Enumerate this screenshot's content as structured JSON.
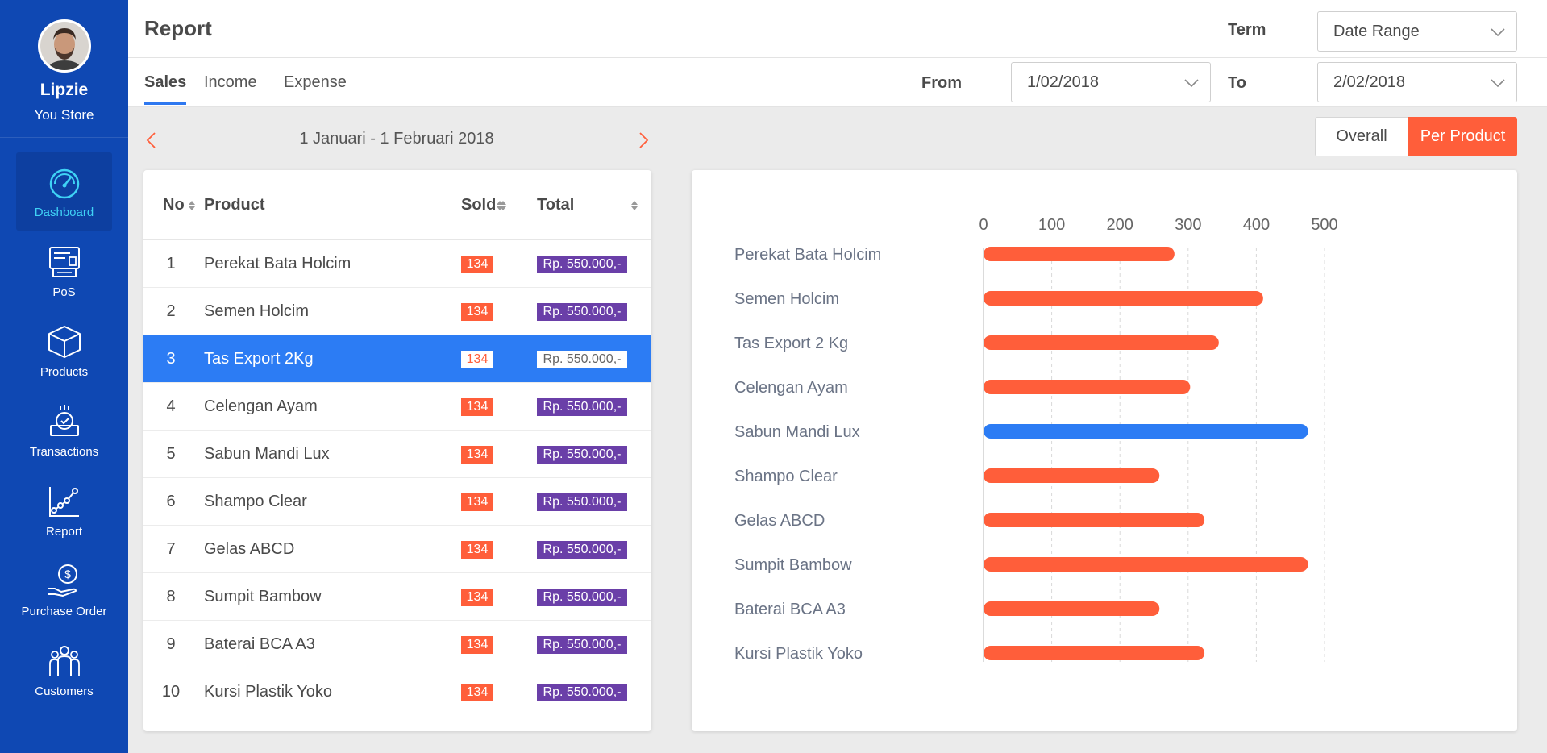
{
  "user": {
    "name": "Lipzie",
    "store": "You Store"
  },
  "sidebar": {
    "items": [
      {
        "label": "Dashboard",
        "icon": "dashboard-gauge-icon",
        "active": true
      },
      {
        "label": "PoS",
        "icon": "pos-register-icon",
        "active": false
      },
      {
        "label": "Products",
        "icon": "product-box-icon",
        "active": false
      },
      {
        "label": "Transactions",
        "icon": "transactions-icon",
        "active": false
      },
      {
        "label": "Report",
        "icon": "report-chart-icon",
        "active": false
      },
      {
        "label": "Purchase Order",
        "icon": "purchase-order-icon",
        "active": false
      },
      {
        "label": "Customers",
        "icon": "customers-icon",
        "active": false
      }
    ]
  },
  "header": {
    "title": "Report",
    "term_label": "Term",
    "term_value": "Date Range"
  },
  "tabs": [
    {
      "label": "Sales",
      "active": true
    },
    {
      "label": "Income",
      "active": false
    },
    {
      "label": "Expense",
      "active": false
    }
  ],
  "filters": {
    "from_label": "From",
    "from_value": "1/02/2018",
    "to_label": "To",
    "to_value": "2/02/2018"
  },
  "period": {
    "label": "1 Januari - 1 Februari 2018"
  },
  "view_toggle": {
    "overall": "Overall",
    "per_product": "Per Product",
    "active": "per_product"
  },
  "table": {
    "columns": [
      "No",
      "Product",
      "Sold",
      "Total"
    ],
    "rows": [
      {
        "no": "1",
        "product": "Perekat Bata Holcim",
        "sold": "134",
        "total": "Rp. 550.000,-"
      },
      {
        "no": "2",
        "product": "Semen Holcim",
        "sold": "134",
        "total": "Rp. 550.000,-"
      },
      {
        "no": "3",
        "product": "Tas Export 2Kg",
        "sold": "134",
        "total": "Rp. 550.000,-",
        "selected": true
      },
      {
        "no": "4",
        "product": "Celengan Ayam",
        "sold": "134",
        "total": "Rp. 550.000,-"
      },
      {
        "no": "5",
        "product": "Sabun Mandi Lux",
        "sold": "134",
        "total": "Rp. 550.000,-"
      },
      {
        "no": "6",
        "product": "Shampo Clear",
        "sold": "134",
        "total": "Rp. 550.000,-"
      },
      {
        "no": "7",
        "product": "Gelas ABCD",
        "sold": "134",
        "total": "Rp. 550.000,-"
      },
      {
        "no": "8",
        "product": "Sumpit Bambow",
        "sold": "134",
        "total": "Rp. 550.000,-"
      },
      {
        "no": "9",
        "product": "Baterai BCA A3",
        "sold": "134",
        "total": "Rp. 550.000,-"
      },
      {
        "no": "10",
        "product": "Kursi Plastik Yoko",
        "sold": "134",
        "total": "Rp. 550.000,-"
      }
    ]
  },
  "colors": {
    "sidebar": "#0f48b3",
    "accent_orange": "#ff5e3a",
    "accent_blue": "#2c7cf4",
    "badge_purple": "#6a3fa8"
  },
  "chart_data": {
    "type": "bar",
    "orientation": "horizontal",
    "categories": [
      "Perekat Bata Holcim",
      "Semen Holcim",
      "Tas Export 2 Kg",
      "Celengan Ayam",
      "Sabun Mandi Lux",
      "Shampo Clear",
      "Gelas ABCD",
      "Sumpit Bambow",
      "Baterai BCA A3",
      "Kursi Plastik Yoko"
    ],
    "values": [
      280,
      410,
      345,
      303,
      476,
      258,
      324,
      476,
      258,
      324
    ],
    "highlight_index": 4,
    "xlim": [
      0,
      500
    ],
    "xticks": [
      0,
      100,
      200,
      300,
      400,
      500
    ],
    "axis_position": "top",
    "grid": true,
    "bar_color": "#ff5e3a",
    "highlight_color": "#2c7cf4"
  }
}
